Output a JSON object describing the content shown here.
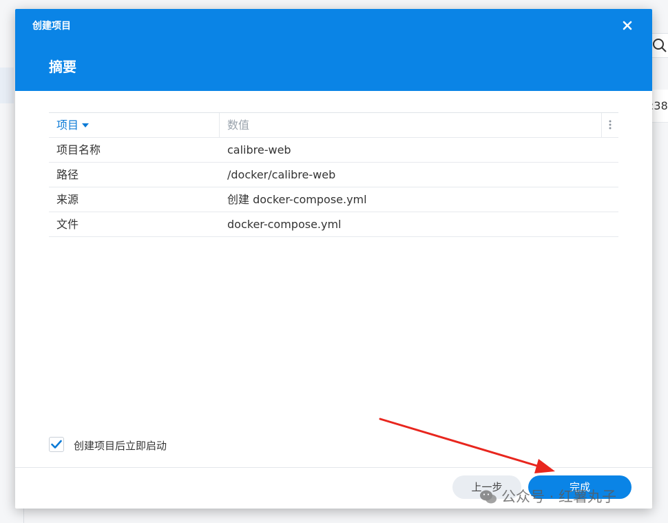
{
  "background": {
    "partial_row_text": ":38"
  },
  "dialog": {
    "title": "创建项目",
    "subtitle": "摘要",
    "table": {
      "headers": {
        "item": "项目",
        "value": "数值"
      },
      "rows": [
        {
          "item": "项目名称",
          "value": "calibre-web"
        },
        {
          "item": "路径",
          "value": "/docker/calibre-web"
        },
        {
          "item": "来源",
          "value": "创建 docker-compose.yml"
        },
        {
          "item": "文件",
          "value": "docker-compose.yml"
        }
      ]
    },
    "start_after_create": {
      "label": "创建项目后立即启动",
      "checked": true
    },
    "buttons": {
      "prev": "上一步",
      "done": "完成"
    }
  },
  "watermark": {
    "text": "公众号 · 红薯丸子"
  },
  "colors": {
    "header_blue": "#0a84e6",
    "arrow_red": "#e8261e"
  },
  "icons": {
    "close": "close-icon",
    "search": "search-icon",
    "sort": "caret-down-icon",
    "menu": "more-vertical-icon",
    "check": "check-icon",
    "logo": "wechat-icon"
  }
}
